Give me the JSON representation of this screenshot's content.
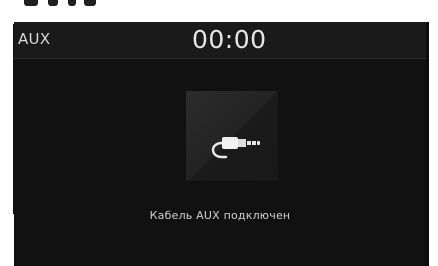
{
  "header": {
    "source": "AUX",
    "time": "00:00"
  },
  "main": {
    "icon": "aux-cable-icon",
    "status": "Кабель AUX подключен"
  },
  "colors": {
    "screen_bg": "#121212",
    "header_bg": "#1a1a1a",
    "text": "#d8d8d8"
  }
}
